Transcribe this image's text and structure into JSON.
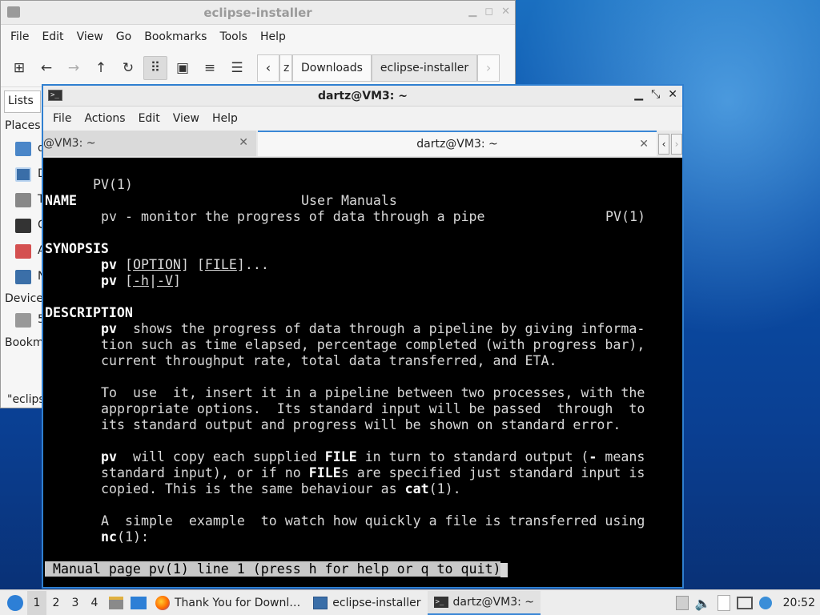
{
  "file_manager": {
    "title": "eclipse-installer",
    "menu": [
      "File",
      "Edit",
      "View",
      "Go",
      "Bookmarks",
      "Tools",
      "Help"
    ],
    "path": {
      "partial_segment": "z",
      "segments": [
        "Downloads",
        "eclipse-installer"
      ]
    },
    "sidebar": {
      "lists_tab": "Lists",
      "places_header": "Places",
      "devices_header": "Device",
      "bookmarks_header": "Bookm",
      "item_initials": [
        "d",
        "D",
        "T",
        "C",
        "A",
        "N",
        "5"
      ]
    },
    "status_text": "\"eclips"
  },
  "terminal": {
    "title": "dartz@VM3: ~",
    "menu": [
      "File",
      "Actions",
      "Edit",
      "View",
      "Help"
    ],
    "tabs": [
      {
        "label": "@VM3: ~",
        "active": false
      },
      {
        "label": "dartz@VM3: ~",
        "active": true
      }
    ],
    "man_page": {
      "header_left": "PV(1)",
      "header_center": "User Manuals",
      "header_right": "PV(1)",
      "name_heading": "NAME",
      "name_text": "pv - monitor the progress of data through a pipe",
      "synopsis_heading": "SYNOPSIS",
      "synopsis_cmd": "pv",
      "synopsis_1_open": "[",
      "synopsis_1_option": "OPTION",
      "synopsis_1_mid": "] [",
      "synopsis_1_file": "FILE",
      "synopsis_1_end": "]...",
      "synopsis_2_open": "[",
      "synopsis_2_h": "-h",
      "synopsis_2_bar": "|",
      "synopsis_2_v": "-V",
      "synopsis_2_end": "]",
      "description_heading": "DESCRIPTION",
      "desc_p1_l1_cmd": "pv",
      "desc_p1_l1_rest": "  shows the progress of data through a pipeline by giving informa-",
      "desc_p1_l2": "tion such as time elapsed, percentage completed (with progress bar),",
      "desc_p1_l3": "current throughput rate, total data transferred, and ETA.",
      "desc_p2_l1": "To  use  it, insert it in a pipeline between two processes, with the",
      "desc_p2_l2": "appropriate options.  Its standard input will be passed  through  to",
      "desc_p2_l3": "its standard output and progress will be shown on standard error.",
      "desc_p3_l1_cmd": "pv",
      "desc_p3_l1_a": "  will copy each supplied ",
      "desc_p3_l1_file": "FILE",
      "desc_p3_l1_b": " in turn to standard output (",
      "desc_p3_l1_dash": "-",
      "desc_p3_l1_c": " means",
      "desc_p3_l2_a": "standard input), or if no ",
      "desc_p3_l2_file": "FILE",
      "desc_p3_l2_b": "s are specified just standard input is",
      "desc_p3_l3_a": "copied. This is the same behaviour as ",
      "desc_p3_l3_cat": "cat",
      "desc_p3_l3_b": "(1).",
      "desc_p4_l1": "A  simple  example  to watch how quickly a file is transferred using",
      "desc_p4_l2_nc": "nc",
      "desc_p4_l2_b": "(1):",
      "status_line": " Manual page pv(1) line 1 (press h for help or q to quit)"
    }
  },
  "taskbar": {
    "workspaces": [
      "1",
      "2",
      "3",
      "4"
    ],
    "active_workspace": "1",
    "tasks": [
      {
        "label": "Thank You for Downl…",
        "icon": "firefox-icon"
      },
      {
        "label": "eclipse-installer",
        "icon": "folder-icon"
      },
      {
        "label": "dartz@VM3: ~",
        "icon": "terminal-icon",
        "active": true
      }
    ],
    "clock": "20:52"
  },
  "colors": {
    "terminal_border": "#2f7fd0",
    "terminal_bg": "#000000",
    "status_line_bg": "#c8c8c8",
    "accent": "#3a87d6"
  }
}
